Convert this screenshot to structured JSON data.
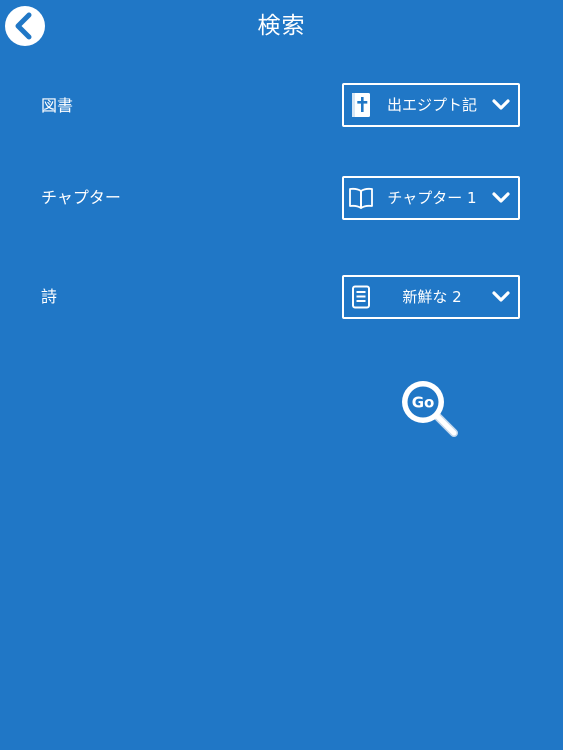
{
  "header": {
    "title": "検索",
    "back_icon": "chevron-left-icon"
  },
  "form": {
    "book": {
      "label": "図書",
      "value": "出エジプト記",
      "icon": "bible-icon"
    },
    "chapter": {
      "label": "チャプター",
      "value": "チャプター 1",
      "icon": "open-book-icon"
    },
    "verse": {
      "label": "詩",
      "value": "新鮮な 2",
      "icon": "document-icon"
    }
  },
  "go_button": {
    "label": "Go",
    "icon": "magnifier-icon"
  },
  "colors": {
    "background": "#2077c6",
    "foreground": "#ffffff"
  }
}
